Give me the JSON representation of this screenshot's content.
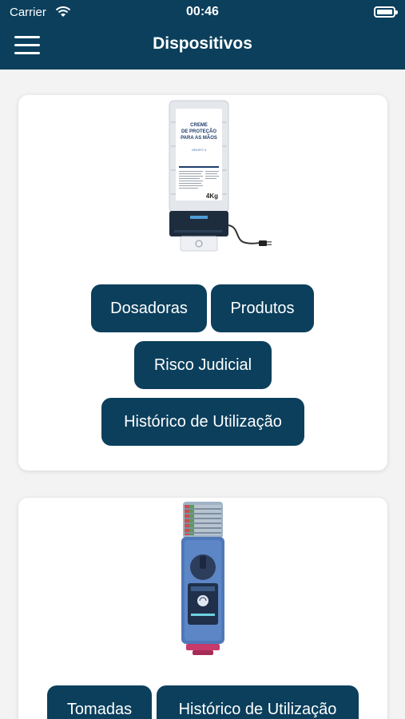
{
  "status_bar": {
    "carrier": "Carrier",
    "time": "00:46"
  },
  "header": {
    "title": "Dispositivos"
  },
  "cards": [
    {
      "image": {
        "label_line1": "CREME",
        "label_line2": "DE PROTEÇÃO",
        "label_line3": "PARA AS MÃOS",
        "label_group": "GRUPO 3",
        "weight": "4Kg"
      },
      "buttons": [
        {
          "label": "Dosadoras"
        },
        {
          "label": "Produtos"
        },
        {
          "label": "Risco Judicial"
        },
        {
          "label": "Histórico de Utilização"
        }
      ]
    },
    {
      "buttons": [
        {
          "label": "Tomadas"
        },
        {
          "label": "Histórico de Utilização"
        }
      ]
    }
  ],
  "colors": {
    "brand": "#0b3f5c",
    "background": "#f3f3f3",
    "card": "#ffffff"
  }
}
